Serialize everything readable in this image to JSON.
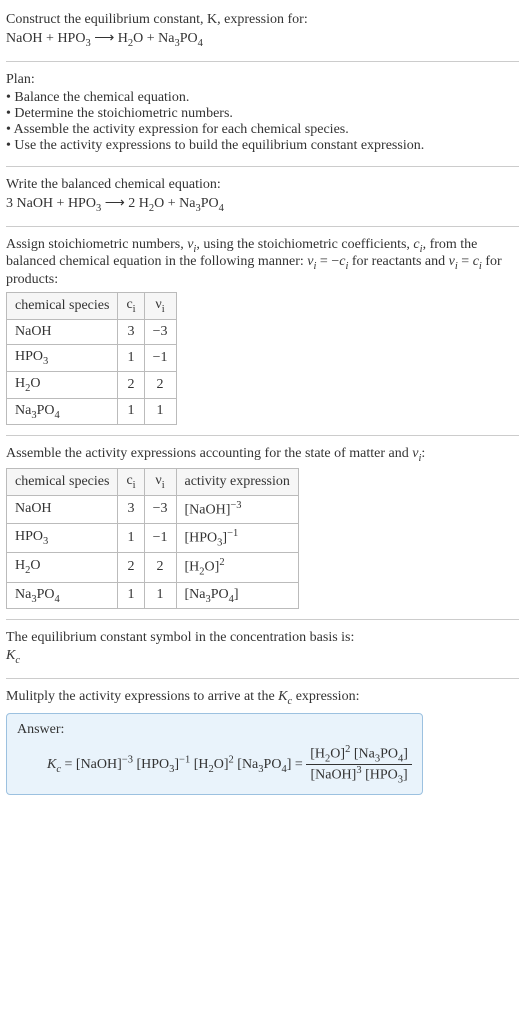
{
  "title_line1": "Construct the equilibrium constant, K, expression for:",
  "title_line2_html": "NaOH + HPO<sub>3</sub> ⟶ H<sub>2</sub>O + Na<sub>3</sub>PO<sub>4</sub>",
  "plan_heading": "Plan:",
  "plan_items": [
    "Balance the chemical equation.",
    "Determine the stoichiometric numbers.",
    "Assemble the activity expression for each chemical species.",
    "Use the activity expressions to build the equilibrium constant expression."
  ],
  "balanced_heading": "Write the balanced chemical equation:",
  "balanced_eq_html": "3 NaOH + HPO<sub>3</sub> ⟶ 2 H<sub>2</sub>O + Na<sub>3</sub>PO<sub>4</sub>",
  "stoich_text_html": "Assign stoichiometric numbers, <span class=\"italic-i\">ν<sub>i</sub></span>, using the stoichiometric coefficients, <span class=\"italic-i\">c<sub>i</sub></span>, from the balanced chemical equation in the following manner: <span class=\"italic-i\">ν<sub>i</sub></span> = &minus;<span class=\"italic-i\">c<sub>i</sub></span> for reactants and <span class=\"italic-i\">ν<sub>i</sub></span> = <span class=\"italic-i\">c<sub>i</sub></span> for products:",
  "table1_headers": [
    "chemical species",
    "c<sub>i</sub>",
    "ν<sub>i</sub>"
  ],
  "table1_rows": [
    {
      "species_html": "NaOH",
      "c": "3",
      "v": "−3"
    },
    {
      "species_html": "HPO<sub>3</sub>",
      "c": "1",
      "v": "−1"
    },
    {
      "species_html": "H<sub>2</sub>O",
      "c": "2",
      "v": "2"
    },
    {
      "species_html": "Na<sub>3</sub>PO<sub>4</sub>",
      "c": "1",
      "v": "1"
    }
  ],
  "activity_text_html": "Assemble the activity expressions accounting for the state of matter and <span class=\"italic-i\">ν<sub>i</sub></span>:",
  "table2_headers": [
    "chemical species",
    "c<sub>i</sub>",
    "ν<sub>i</sub>",
    "activity expression"
  ],
  "table2_rows": [
    {
      "species_html": "NaOH",
      "c": "3",
      "v": "−3",
      "act_html": "[NaOH]<sup>−3</sup>"
    },
    {
      "species_html": "HPO<sub>3</sub>",
      "c": "1",
      "v": "−1",
      "act_html": "[HPO<sub>3</sub>]<sup>−1</sup>"
    },
    {
      "species_html": "H<sub>2</sub>O",
      "c": "2",
      "v": "2",
      "act_html": "[H<sub>2</sub>O]<sup>2</sup>"
    },
    {
      "species_html": "Na<sub>3</sub>PO<sub>4</sub>",
      "c": "1",
      "v": "1",
      "act_html": "[Na<sub>3</sub>PO<sub>4</sub>]"
    }
  ],
  "kc_symbol_line1": "The equilibrium constant symbol in the concentration basis is:",
  "kc_symbol_line2_html": "<span class=\"italic-i\">K<sub>c</sub></span>",
  "multiply_text": "Mulitply the activity expressions to arrive at the K_c expression:",
  "multiply_text_html": "Mulitply the activity expressions to arrive at the <span class=\"italic-i\">K<sub>c</sub></span> expression:",
  "answer_label": "Answer:",
  "answer_eq_left_html": "<span class=\"italic-i\">K<sub>c</sub></span> = [NaOH]<sup>−3</sup> [HPO<sub>3</sub>]<sup>−1</sup> [H<sub>2</sub>O]<sup>2</sup> [Na<sub>3</sub>PO<sub>4</sub>] = ",
  "answer_frac_num_html": "[H<sub>2</sub>O]<sup>2</sup> [Na<sub>3</sub>PO<sub>4</sub>]",
  "answer_frac_den_html": "[NaOH]<sup>3</sup> [HPO<sub>3</sub>]",
  "chart_data": {
    "type": "table",
    "tables": [
      {
        "title": "Stoichiometric numbers",
        "columns": [
          "chemical species",
          "c_i",
          "ν_i"
        ],
        "rows": [
          [
            "NaOH",
            3,
            -3
          ],
          [
            "HPO3",
            1,
            -1
          ],
          [
            "H2O",
            2,
            2
          ],
          [
            "Na3PO4",
            1,
            1
          ]
        ]
      },
      {
        "title": "Activity expressions",
        "columns": [
          "chemical species",
          "c_i",
          "ν_i",
          "activity expression"
        ],
        "rows": [
          [
            "NaOH",
            3,
            -3,
            "[NaOH]^-3"
          ],
          [
            "HPO3",
            1,
            -1,
            "[HPO3]^-1"
          ],
          [
            "H2O",
            2,
            2,
            "[H2O]^2"
          ],
          [
            "Na3PO4",
            1,
            1,
            "[Na3PO4]"
          ]
        ]
      }
    ]
  }
}
